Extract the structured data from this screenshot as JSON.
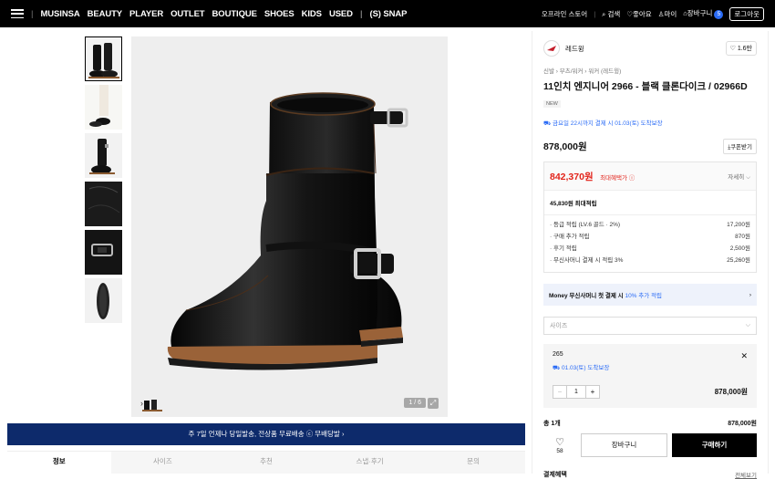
{
  "topbar": {
    "brand": "MUSINSA",
    "nav": [
      "BEAUTY",
      "PLAYER",
      "OUTLET",
      "BOUTIQUE",
      "SHOES",
      "KIDS",
      "USED"
    ],
    "snap": "(S) SNAP",
    "offline_store": "오프라인 스토어",
    "search": "검색",
    "likes": "좋아요",
    "my": "마이",
    "cart": "장바구니",
    "cart_count": "5",
    "login": "로그아웃"
  },
  "gallery": {
    "counter": "1 / 6",
    "thumb_count": 6
  },
  "promo_banner": "주 7일 언제나 당일발송, 전상품 무료배송 ⓒ 무배당발 ›",
  "tabs": [
    "정보",
    "사이즈",
    "추천",
    "스냅·후기",
    "문의"
  ],
  "product": {
    "brand": "레드윙",
    "like_count": "1.6만",
    "breadcrumb": "신발 › 부츠/워커 › 워커 (레드윙)",
    "title": "11인치 엔지니어 2966 - 블랙 클론다이크 / 02966D",
    "badge": "NEW",
    "delivery_note": "금요일 22시까지 결제 시 01.03(토) 도착보장",
    "price": "878,000원",
    "coupon_label": "쿠폰받기",
    "max_benefit_price": "842,370원",
    "max_benefit_label": "최대혜택가 ⓘ",
    "detail_label": "자세히",
    "points_total": "45,830원 최대적립",
    "points": [
      {
        "label": "· 등급 적립 (LV.6 골드 · 2%)",
        "value": "17,200원"
      },
      {
        "label": "· 구매 추가 적립",
        "value": "870원"
      },
      {
        "label": "· 후기 적립",
        "value": "2,500원"
      },
      {
        "label": "· 무신사머니 결제 시 적립 3%",
        "value": "25,260원"
      }
    ],
    "money_promo_prefix": "Money 무신사머니 첫 결제 시",
    "money_promo_highlight": "10% 추가 적립",
    "size_placeholder": "사이즈",
    "option": {
      "size": "265",
      "delivery": "01.03(토) 도착보장",
      "qty": "1",
      "price": "878,000원"
    },
    "total_label": "총 1개",
    "total_price": "878,000원",
    "wish_count": "58",
    "cart_button": "장바구니",
    "buy_button": "구매하기",
    "pay_benefit_label": "결제혜택",
    "pay_benefit_link": "전체보기"
  }
}
